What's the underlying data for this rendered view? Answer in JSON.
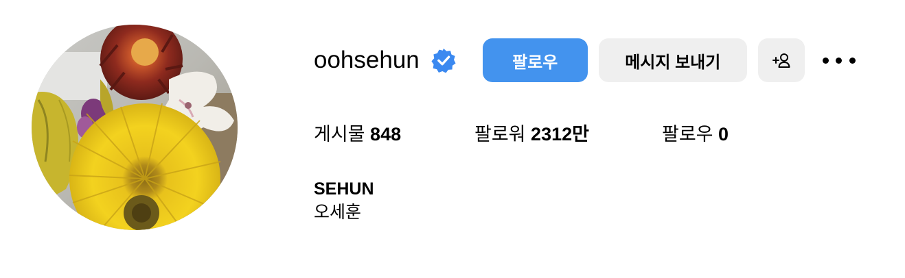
{
  "profile": {
    "username": "oohsehun",
    "verified": true,
    "full_name": "SEHUN",
    "bio": "오세훈"
  },
  "actions": {
    "follow_label": "팔로우",
    "message_label": "메시지 보내기",
    "suggest_label": "+♀"
  },
  "stats": {
    "posts_label": "게시물",
    "posts_count": "848",
    "followers_label": "팔로워",
    "followers_count": "2312만",
    "following_label": "팔로우",
    "following_count": "0"
  },
  "icons": {
    "verified": "verified-badge-icon",
    "more": "more-options-icon",
    "suggest": "add-person-icon"
  },
  "colors": {
    "accent": "#4393ee",
    "button_secondary": "#efefef",
    "verified_badge": "#3b89f0"
  }
}
